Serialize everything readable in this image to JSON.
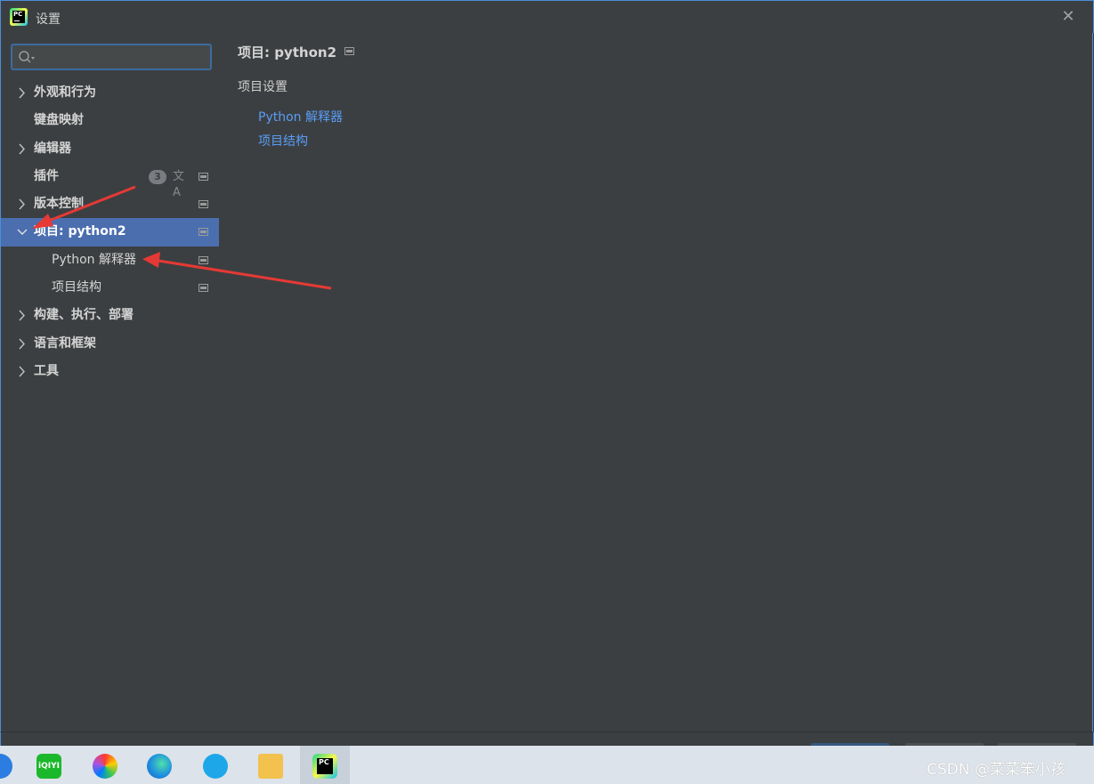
{
  "window": {
    "title": "设置",
    "close_glyph": "✕"
  },
  "search": {
    "placeholder": "",
    "icon": "search-icon"
  },
  "tree": [
    {
      "label": "外观和行为",
      "expandable": true,
      "expanded": false
    },
    {
      "label": "键盘映射",
      "expandable": false
    },
    {
      "label": "编辑器",
      "expandable": true,
      "expanded": false
    },
    {
      "label": "插件",
      "expandable": false,
      "badge": "3",
      "translate_icon": "文A"
    },
    {
      "label": "版本控制",
      "expandable": true,
      "expanded": false
    },
    {
      "label": "项目: python2",
      "expandable": true,
      "expanded": true,
      "selected": true
    },
    {
      "label": "Python 解释器",
      "child": true
    },
    {
      "label": "项目结构",
      "child": true
    },
    {
      "label": "构建、执行、部署",
      "expandable": true,
      "expanded": false
    },
    {
      "label": "语言和框架",
      "expandable": true,
      "expanded": false
    },
    {
      "label": "工具",
      "expandable": true,
      "expanded": false
    }
  ],
  "main": {
    "title": "项目: python2",
    "section_title": "项目设置",
    "links": [
      "Python 解释器",
      "项目结构"
    ]
  },
  "taskbar": {
    "watermark": "CSDN @菜菜笨小孩",
    "app_icon_text": "PC",
    "iqiyi_label": "iQIYI"
  },
  "colors": {
    "background": "#3c3f41",
    "selection": "#4b6eaf",
    "link": "#589df6",
    "arrow": "#e53935"
  }
}
